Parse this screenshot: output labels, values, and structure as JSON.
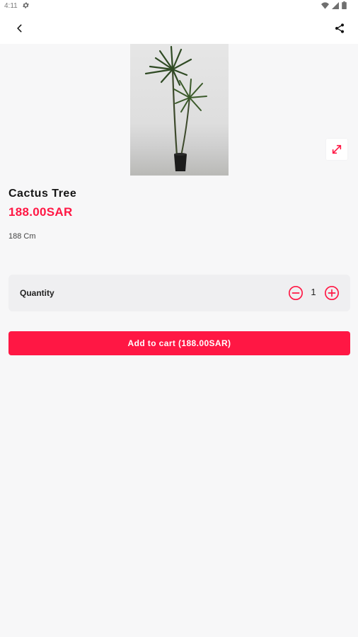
{
  "status_bar": {
    "time": "4:11",
    "icons": [
      "gear-icon",
      "wifi-icon",
      "signal-icon",
      "battery-icon"
    ]
  },
  "app_bar": {
    "back_icon": "back-arrow-icon",
    "share_icon": "share-icon"
  },
  "product": {
    "image_icon": "potted-plant-image",
    "expand_icon": "expand-icon",
    "name": "Cactus Tree",
    "price": "188.00SAR",
    "description": "188 Cm"
  },
  "quantity": {
    "label": "Quantity",
    "value": "1",
    "minus_icon": "minus-circle-icon",
    "plus_icon": "plus-circle-icon"
  },
  "cart": {
    "button_label": "Add to cart (188.00SAR)"
  },
  "colors": {
    "accent": "#ff1744",
    "background": "#f7f7f8",
    "quantity_bg": "#efeff1"
  }
}
